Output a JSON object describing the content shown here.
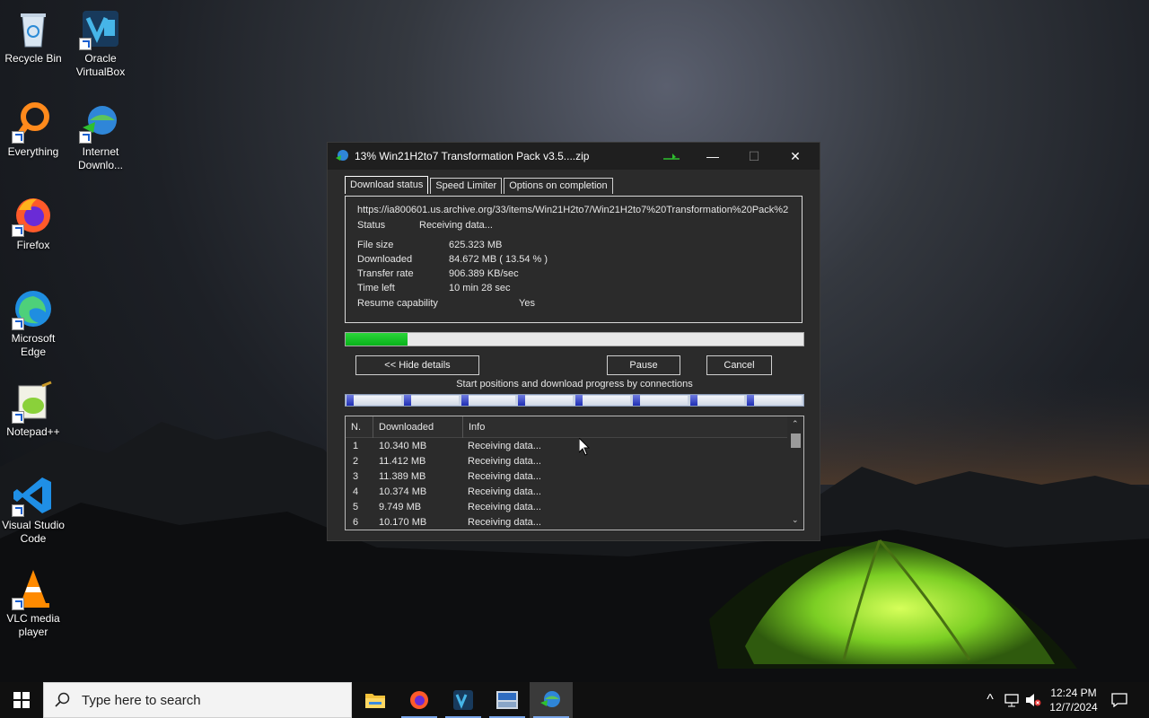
{
  "desktop": {
    "icons": [
      {
        "label": "Recycle Bin"
      },
      {
        "label": "Oracle VirtualBox"
      },
      {
        "label": "Everything"
      },
      {
        "label": "Internet Downlo..."
      },
      {
        "label": "Firefox"
      },
      {
        "label": "Microsoft Edge"
      },
      {
        "label": "Notepad++"
      },
      {
        "label": "Visual Studio Code"
      },
      {
        "label": "VLC media player"
      }
    ]
  },
  "window": {
    "title": "13% Win21H2to7 Transformation Pack v3.5....zip",
    "percent_in_title": 13,
    "tabs": [
      "Download status",
      "Speed Limiter",
      "Options on completion"
    ],
    "active_tab": "Download status",
    "url": "https://ia800601.us.archive.org/33/items/Win21H2to7/Win21H2to7%20Transformation%20Pack%2",
    "status_label": "Status",
    "status_value": "Receiving data...",
    "details": [
      {
        "label": "File size",
        "value": "625.323  MB"
      },
      {
        "label": "Downloaded",
        "value": "84.672  MB  ( 13.54 % )"
      },
      {
        "label": "Transfer rate",
        "value": "906.389  KB/sec"
      },
      {
        "label": "Time left",
        "value": "10 min 28 sec"
      },
      {
        "label": "Resume capability",
        "value": "Yes"
      }
    ],
    "progress_percent": 13.54,
    "buttons": {
      "hide_details": "<< Hide details",
      "pause": "Pause",
      "cancel": "Cancel"
    },
    "connections_caption": "Start positions and download progress by connections",
    "connection_count": 8,
    "table": {
      "headers": [
        "N.",
        "Downloaded",
        "Info"
      ],
      "rows": [
        {
          "n": "1",
          "downloaded": "10.340  MB",
          "info": "Receiving data..."
        },
        {
          "n": "2",
          "downloaded": "11.412  MB",
          "info": "Receiving data..."
        },
        {
          "n": "3",
          "downloaded": "11.389  MB",
          "info": "Receiving data..."
        },
        {
          "n": "4",
          "downloaded": "10.374  MB",
          "info": "Receiving data..."
        },
        {
          "n": "5",
          "downloaded": "9.749  MB",
          "info": "Receiving data..."
        },
        {
          "n": "6",
          "downloaded": "10.170  MB",
          "info": "Receiving data..."
        }
      ]
    }
  },
  "taskbar": {
    "search_placeholder": "Type here to search",
    "time": "12:24 PM",
    "date": "12/7/2024"
  },
  "colors": {
    "progress_fill": "#14c226",
    "connection_marker": "#2a3ac0",
    "taskbar_running_indicator": "#79a5e8"
  }
}
